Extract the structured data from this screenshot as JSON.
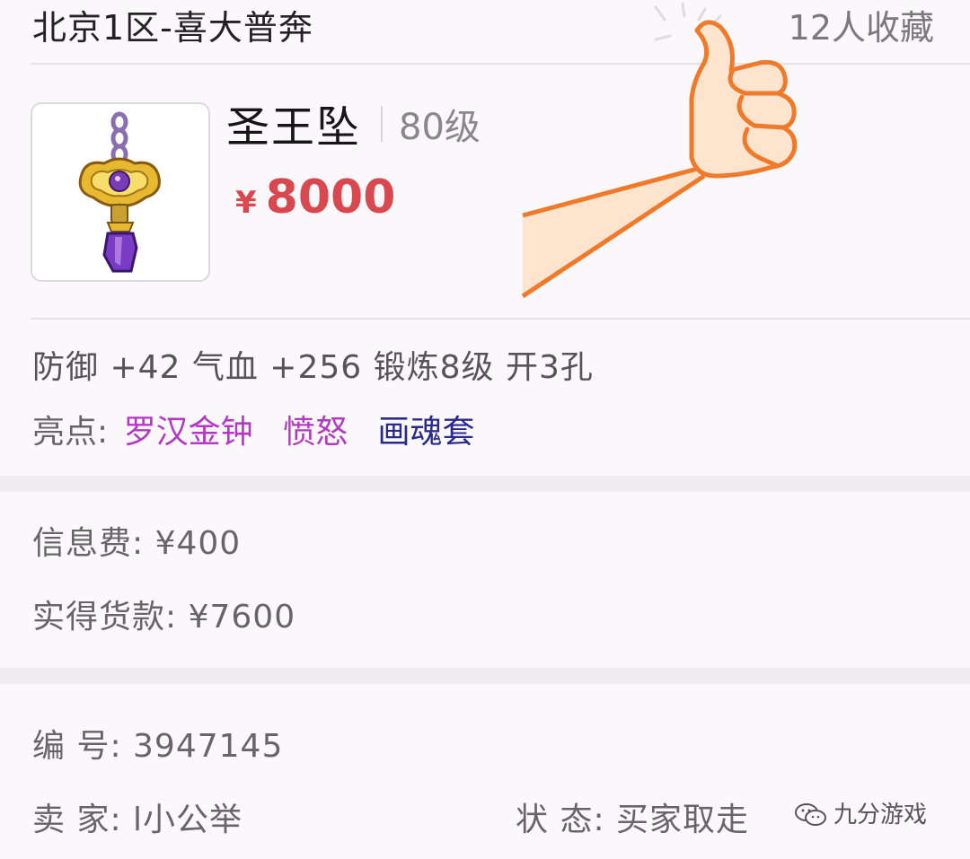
{
  "header": {
    "server": "北京1区-喜大普奔",
    "favorites": "12人收藏"
  },
  "item": {
    "name": "圣王坠",
    "level": "80级",
    "currency_symbol": "¥",
    "price": "8000",
    "image_icon": "purple-gem-pendant-icon"
  },
  "attributes": "防御 +42 气血 +256 锻炼8级 开3孔",
  "highlights": {
    "label": "亮点:",
    "tags": [
      {
        "text": "罗汉金钟",
        "color": "#b23ac2"
      },
      {
        "text": "愤怒",
        "color": "#b23ac2"
      },
      {
        "text": "画魂套",
        "color": "#2a2a8c"
      }
    ]
  },
  "fees": {
    "info_fee": "信息费: ¥400",
    "net_payment": "实得货款: ¥7600"
  },
  "details": {
    "serial": "编 号:  3947145",
    "seller": "卖 家:  l小公举",
    "status": "状 态:  买家取走"
  },
  "overlay": {
    "thumbs_up_icon": "thumbs-up-hand-icon",
    "watermark_text": "九分游戏"
  },
  "colors": {
    "price": "#d8484e",
    "highlight_purple": "#b23ac2",
    "highlight_navy": "#2a2a8c",
    "hand_outline": "#f07a2a",
    "hand_fill": "#fde4cf"
  }
}
